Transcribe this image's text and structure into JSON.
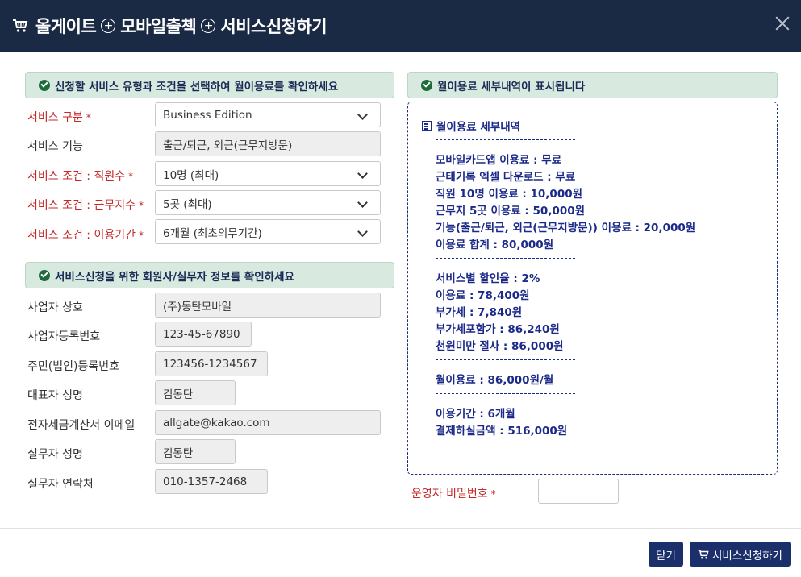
{
  "header": {
    "title_part1": "올게이트",
    "title_part2": "모바일출첵",
    "title_part3": "서비스신청하기"
  },
  "section1": {
    "heading": "신청할 서비스 유형과 조건을 선택하여 월이용료를 확인하세요",
    "rows": [
      {
        "label": "서비스 구분",
        "required": true,
        "value": "Business Edition"
      },
      {
        "label": "서비스 기능",
        "required": false,
        "value": "출근/퇴근, 외근(근무지방문)"
      },
      {
        "label": "서비스 조건 : 직원수",
        "required": true,
        "value": "10명 (최대)"
      },
      {
        "label": "서비스 조건 : 근무지수",
        "required": true,
        "value": "5곳 (최대)"
      },
      {
        "label": "서비스 조건 : 이용기간",
        "required": true,
        "value": "6개월 (최초의무기간)"
      }
    ]
  },
  "section2": {
    "heading": "서비스신청을 위한 회원사/실무자 정보를 확인하세요",
    "rows": [
      {
        "label": "사업자 상호",
        "value": "(주)동탄모바일"
      },
      {
        "label": "사업자등록번호",
        "value": "123-45-67890"
      },
      {
        "label": "주민(법인)등록번호",
        "value": "123456-1234567"
      },
      {
        "label": "대표자 성명",
        "value": "김동탄"
      },
      {
        "label": "전자세금계산서 이메일",
        "value": "allgate@kakao.com"
      },
      {
        "label": "실무자 성명",
        "value": "김동탄"
      },
      {
        "label": "실무자 연락처",
        "value": "010-1357-2468"
      }
    ]
  },
  "detail": {
    "heading": "월이용료 세부내역이 표시됩니다",
    "box_title": "월이용료 세부내역",
    "separator": "----------------------------",
    "lines": [
      "모바일카드앱 이용료 : 무료",
      "근태기록 엑셀 다운로드 : 무료",
      "직원 10명 이용료 : 10,000원",
      "근무지 5곳 이용료 : 50,000원",
      "기능(출근/퇴근, 외근(근무지방문)) 이용료 : 20,000원",
      "이용료 합계 : 80,000원",
      "서비스별 할인율 : 2%",
      "이용료 : 78,400원",
      "부가세 : 7,840원",
      "부가세포함가 : 86,240원",
      "천원미만 절사 : 86,000원",
      "월이용료 : 86,000원/월",
      "이용기간 : 6개월",
      "결제하실금액 : 516,000원"
    ]
  },
  "password": {
    "label": "운영자 비밀번호",
    "value": ""
  },
  "footer": {
    "close_label": "닫기",
    "submit_label": "서비스신청하기"
  },
  "required_mark": "*",
  "colors": {
    "header_bg": "#1b2a44",
    "section_bg": "#d8eadf",
    "required": "#c62828",
    "detail_text": "#1b2a88",
    "button_bg": "#1b2f6b"
  },
  "icons": [
    "cart-icon",
    "plus-circle-icon",
    "close-icon",
    "check-circle-icon",
    "document-icon",
    "chevron-down-icon"
  ]
}
